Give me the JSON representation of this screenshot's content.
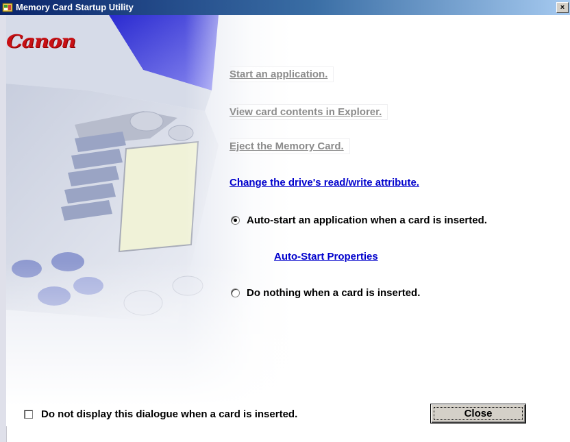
{
  "window": {
    "title": "Memory Card Startup Utility",
    "close_glyph": "×"
  },
  "brand": {
    "logo_text": "Canon",
    "logo_color": "#c81014"
  },
  "actions": {
    "start_app": "Start an application.",
    "view_explorer": "View card contents in Explorer.",
    "eject": "Eject the Memory Card.",
    "change_attr": "Change the drive's read/write attribute."
  },
  "options": {
    "auto_start_label": "Auto-start an application when a card is inserted.",
    "auto_start_selected": true,
    "auto_start_properties": "Auto-Start Properties",
    "do_nothing_label": "Do nothing when a card is inserted.",
    "do_nothing_selected": false
  },
  "footer": {
    "dont_display_label": "Do not display this dialogue when a card is inserted.",
    "dont_display_checked": false,
    "close_label": "Close"
  },
  "colors": {
    "link_active": "#0000cc",
    "link_disabled": "#8c8c8c",
    "titlebar_start": "#0a246a",
    "titlebar_end": "#a6caf0"
  }
}
